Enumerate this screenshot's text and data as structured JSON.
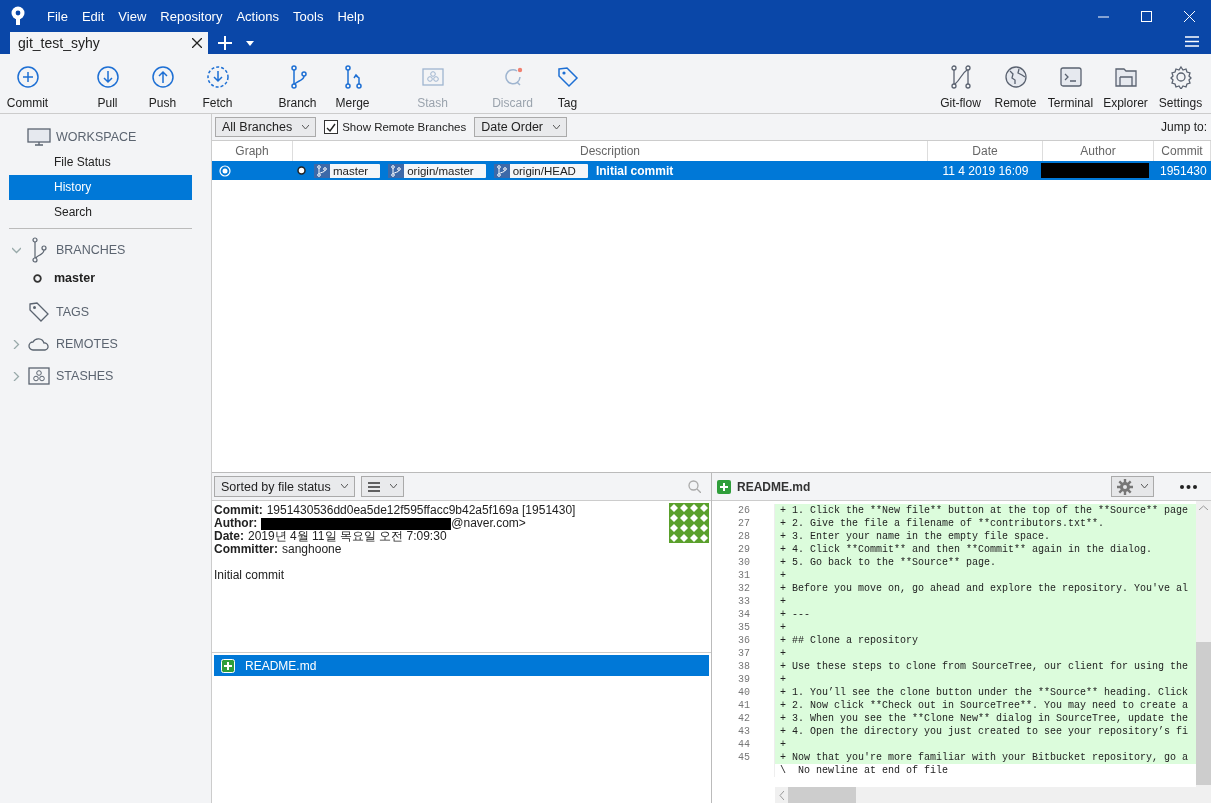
{
  "menu": [
    "File",
    "Edit",
    "View",
    "Repository",
    "Actions",
    "Tools",
    "Help"
  ],
  "tabs": [
    {
      "label": "git_test_syhy",
      "selected": true
    }
  ],
  "toolbar": {
    "left": [
      {
        "kind": "commit",
        "label": "Commit",
        "disabled": false
      },
      {
        "kind": "pull",
        "label": "Pull",
        "disabled": false
      },
      {
        "kind": "push",
        "label": "Push",
        "disabled": false
      },
      {
        "kind": "fetch",
        "label": "Fetch",
        "disabled": false
      },
      {
        "kind": "branch",
        "label": "Branch",
        "disabled": false
      },
      {
        "kind": "merge",
        "label": "Merge",
        "disabled": false
      },
      {
        "kind": "stash",
        "label": "Stash",
        "disabled": true
      },
      {
        "kind": "discard",
        "label": "Discard",
        "disabled": true
      },
      {
        "kind": "tag",
        "label": "Tag",
        "disabled": false
      }
    ],
    "right": [
      {
        "kind": "gitflow",
        "label": "Git-flow",
        "disabled": false
      },
      {
        "kind": "remote",
        "label": "Remote",
        "disabled": false
      },
      {
        "kind": "terminal",
        "label": "Terminal",
        "disabled": false
      },
      {
        "kind": "explorer",
        "label": "Explorer",
        "disabled": false
      },
      {
        "kind": "settings",
        "label": "Settings",
        "disabled": false
      }
    ]
  },
  "sidebar": {
    "sections": [
      {
        "kind": "workspace",
        "label": "WORKSPACE",
        "items": [
          {
            "label": "File Status",
            "selected": false
          },
          {
            "label": "History",
            "selected": true
          },
          {
            "label": "Search",
            "selected": false
          }
        ]
      },
      {
        "kind": "branches",
        "label": "BRANCHES",
        "expanded": true,
        "items": [
          {
            "label": "master",
            "current": true
          }
        ]
      },
      {
        "kind": "tags",
        "label": "TAGS"
      },
      {
        "kind": "remotes",
        "label": "REMOTES",
        "expanded": false
      },
      {
        "kind": "stashes",
        "label": "STASHES",
        "expanded": false
      }
    ]
  },
  "history": {
    "branch_filter": "All Branches",
    "show_remote": {
      "label": "Show Remote Branches",
      "checked": true
    },
    "order": "Date Order",
    "jump_label": "Jump to:",
    "columns": [
      "Graph",
      "Description",
      "Date",
      "Author",
      "Commit"
    ],
    "rows": [
      {
        "selected": true,
        "refs": [
          "master",
          "origin/master",
          "origin/HEAD"
        ],
        "description": "Initial commit",
        "date": "11 4 2019 16:09",
        "commit": "1951430"
      }
    ]
  },
  "details": {
    "sort": "Sorted by file status",
    "fields": [
      {
        "label": "Commit:",
        "value": "1951430536dd0ea5de12f595ffacc9b42a5f169a [1951430]",
        "redacted": false
      },
      {
        "label": "Author:",
        "value": "@naver.com>",
        "redacted": true
      },
      {
        "label": "Date:",
        "value": "2019년 4월 11일 목요일 오전 7:09:30",
        "redacted": false
      },
      {
        "label": "Committer:",
        "value": "sanghoone",
        "redacted": false
      }
    ],
    "message": "Initial commit",
    "files": [
      {
        "name": "README.md",
        "kind": "added",
        "selected": true
      }
    ]
  },
  "diff": {
    "file": "README.md",
    "kind": "added",
    "lines": [
      {
        "kind": "added",
        "number": "26",
        "text": "+ 1. Click the **New file** button at the top of the **Source** page"
      },
      {
        "kind": "added",
        "number": "27",
        "text": "+ 2. Give the file a filename of **contributors.txt**."
      },
      {
        "kind": "added",
        "number": "28",
        "text": "+ 3. Enter your name in the empty file space."
      },
      {
        "kind": "added",
        "number": "29",
        "text": "+ 4. Click **Commit** and then **Commit** again in the dialog."
      },
      {
        "kind": "added",
        "number": "30",
        "text": "+ 5. Go back to the **Source** page."
      },
      {
        "kind": "added",
        "number": "31",
        "text": "+"
      },
      {
        "kind": "added",
        "number": "32",
        "text": "+ Before you move on, go ahead and explore the repository. You've al"
      },
      {
        "kind": "added",
        "number": "33",
        "text": "+"
      },
      {
        "kind": "added",
        "number": "34",
        "text": "+ ---"
      },
      {
        "kind": "added",
        "number": "35",
        "text": "+"
      },
      {
        "kind": "added",
        "number": "36",
        "text": "+ ## Clone a repository"
      },
      {
        "kind": "added",
        "number": "37",
        "text": "+"
      },
      {
        "kind": "added",
        "number": "38",
        "text": "+ Use these steps to clone from SourceTree, our client for using the"
      },
      {
        "kind": "added",
        "number": "39",
        "text": "+"
      },
      {
        "kind": "added",
        "number": "40",
        "text": "+ 1. You’ll see the clone button under the **Source** heading. Click"
      },
      {
        "kind": "added",
        "number": "41",
        "text": "+ 2. Now click **Check out in SourceTree**. You may need to create a"
      },
      {
        "kind": "added",
        "number": "42",
        "text": "+ 3. When you see the **Clone New** dialog in SourceTree, update the"
      },
      {
        "kind": "added",
        "number": "43",
        "text": "+ 4. Open the directory you just created to see your repository’s fi"
      },
      {
        "kind": "added",
        "number": "44",
        "text": "+"
      },
      {
        "kind": "added",
        "number": "45",
        "text": "+ Now that you're more familiar with your Bitbucket repository, go a"
      },
      {
        "kind": "note",
        "text": "\\  No newline at end of file"
      }
    ]
  }
}
